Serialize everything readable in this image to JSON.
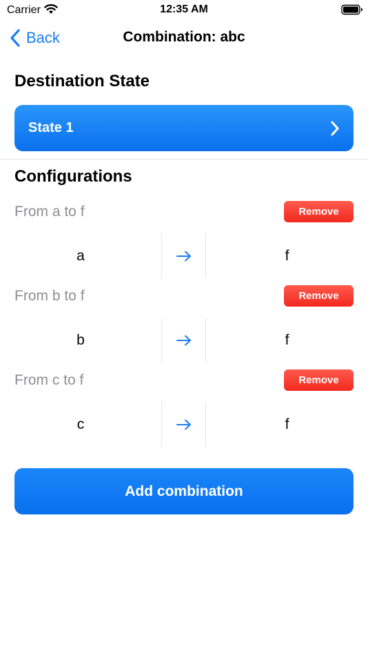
{
  "status_bar": {
    "carrier": "Carrier",
    "time": "12:35 AM",
    "icons": [
      "wifi-icon",
      "battery-icon"
    ]
  },
  "nav": {
    "back_label": "Back",
    "title": "Combination: abc",
    "back_icon": "chevron-left-icon"
  },
  "destination": {
    "section_title": "Destination State",
    "state_label": "State 1",
    "icon": "chevron-right-icon"
  },
  "configurations": {
    "section_title": "Configurations",
    "remove_label": "Remove",
    "arrow_icon": "arrow-right-icon",
    "items": [
      {
        "label": "From a to f",
        "from": "a",
        "to": "f"
      },
      {
        "label": "From b to f",
        "from": "b",
        "to": "f"
      },
      {
        "label": "From c to f",
        "from": "c",
        "to": "f"
      }
    ]
  },
  "add_button_label": "Add combination",
  "colors": {
    "accent": "#1a7cf4",
    "button_blue": "#0a70ee",
    "remove_red": "#f2291d",
    "secondary_text": "#8e8e93"
  }
}
